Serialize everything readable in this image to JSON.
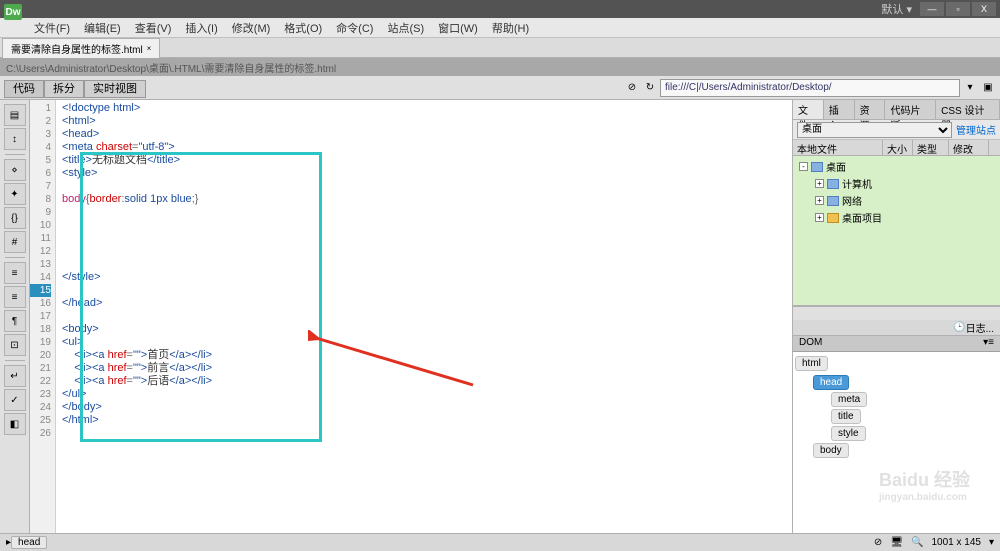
{
  "app": {
    "logo": "Dw",
    "default_layout": "默认 ▾"
  },
  "window_buttons": {
    "min": "—",
    "max": "▫",
    "close": "X"
  },
  "menu": [
    "文件(F)",
    "编辑(E)",
    "查看(V)",
    "插入(I)",
    "修改(M)",
    "格式(O)",
    "命令(C)",
    "站点(S)",
    "窗口(W)",
    "帮助(H)"
  ],
  "tab": {
    "name": "需要清除自身属性的标签.html",
    "close": "×"
  },
  "pathbar": "C:\\Users\\Administrator\\Desktop\\桌面\\.HTML\\需要清除自身属性的标签.html",
  "views": [
    "代码",
    "拆分",
    "实时视图"
  ],
  "address": "file:///C|/Users/Administrator/Desktop/",
  "code_lines": [
    {
      "n": 1,
      "html": "<span class='tag'>&lt;!doctype html&gt;</span>"
    },
    {
      "n": 2,
      "html": "<span class='tag'>&lt;html&gt;</span>"
    },
    {
      "n": 3,
      "html": "<span class='tag'>&lt;head&gt;</span>"
    },
    {
      "n": 4,
      "html": "<span class='tag'>&lt;meta</span> <span class='attr'>charset</span>=<span class='val'>\"utf-8\"</span><span class='tag'>&gt;</span>"
    },
    {
      "n": 5,
      "html": "<span class='tag'>&lt;title&gt;</span><span class='txt'>无标题文档</span><span class='tag'>&lt;/title&gt;</span>"
    },
    {
      "n": 6,
      "html": "<span class='tag'>&lt;style&gt;</span>"
    },
    {
      "n": 7,
      "html": ""
    },
    {
      "n": 8,
      "html": "<span class='sel'>body</span>{<span class='attr'>border</span>:<span class='val'>solid 1px blue</span>;}"
    },
    {
      "n": 9,
      "html": ""
    },
    {
      "n": 10,
      "html": ""
    },
    {
      "n": 11,
      "html": ""
    },
    {
      "n": 12,
      "html": ""
    },
    {
      "n": 13,
      "html": ""
    },
    {
      "n": 14,
      "html": "<span class='tag'>&lt;/style&gt;</span>"
    },
    {
      "n": 15,
      "html": "",
      "active": true
    },
    {
      "n": 16,
      "html": "<span class='tag'>&lt;/head&gt;</span>"
    },
    {
      "n": 17,
      "html": ""
    },
    {
      "n": 18,
      "html": "<span class='tag'>&lt;body&gt;</span>"
    },
    {
      "n": 19,
      "html": "<span class='tag'>&lt;ul&gt;</span>"
    },
    {
      "n": 20,
      "html": "    <span class='tag'>&lt;li&gt;&lt;a</span> <span class='attr'>href</span>=<span class='val'>\"\"</span><span class='tag'>&gt;</span><span class='txt'>首页</span><span class='tag'>&lt;/a&gt;&lt;/li&gt;</span>"
    },
    {
      "n": 21,
      "html": "    <span class='tag'>&lt;li&gt;&lt;a</span> <span class='attr'>href</span>=<span class='val'>\"\"</span><span class='tag'>&gt;</span><span class='txt'>前言</span><span class='tag'>&lt;/a&gt;&lt;/li&gt;</span>"
    },
    {
      "n": 22,
      "html": "    <span class='tag'>&lt;li&gt;&lt;a</span> <span class='attr'>href</span>=<span class='val'>\"\"</span><span class='tag'>&gt;</span><span class='txt'>后语</span><span class='tag'>&lt;/a&gt;&lt;/li&gt;</span>"
    },
    {
      "n": 23,
      "html": "<span class='tag'>&lt;/ul&gt;</span>"
    },
    {
      "n": 24,
      "html": "<span class='tag'>&lt;/body&gt;</span>"
    },
    {
      "n": 25,
      "html": "<span class='tag'>&lt;/html&gt;</span>"
    },
    {
      "n": 26,
      "html": ""
    }
  ],
  "right": {
    "tabs": [
      "文件",
      "插入",
      "资源",
      "代码片断",
      "CSS 设计器"
    ],
    "site_selected": "桌面",
    "manage_link": "管理站点",
    "file_headers": [
      "本地文件",
      "大小",
      "类型",
      "修改"
    ],
    "tree": [
      {
        "indent": 0,
        "exp": "-",
        "icon": "drive",
        "label": "桌面"
      },
      {
        "indent": 1,
        "exp": "+",
        "icon": "drive",
        "label": "计算机"
      },
      {
        "indent": 1,
        "exp": "+",
        "icon": "drive",
        "label": "网络"
      },
      {
        "indent": 1,
        "exp": "+",
        "icon": "folder",
        "label": "桌面项目"
      }
    ],
    "log": "日志...",
    "dom_title": "DOM",
    "dom": [
      {
        "label": "html",
        "cls": ""
      },
      {
        "label": "head",
        "cls": "dom-indent-1 selected"
      },
      {
        "label": "meta",
        "cls": "dom-indent-2"
      },
      {
        "label": "title",
        "cls": "dom-indent-2"
      },
      {
        "label": "style",
        "cls": "dom-indent-2"
      },
      {
        "label": "body",
        "cls": "dom-indent-1"
      }
    ]
  },
  "status": {
    "crumb": "head",
    "dims": "1001 x 145"
  },
  "watermark": {
    "main": "Baidu 经验",
    "sub": "jingyan.baidu.com"
  }
}
